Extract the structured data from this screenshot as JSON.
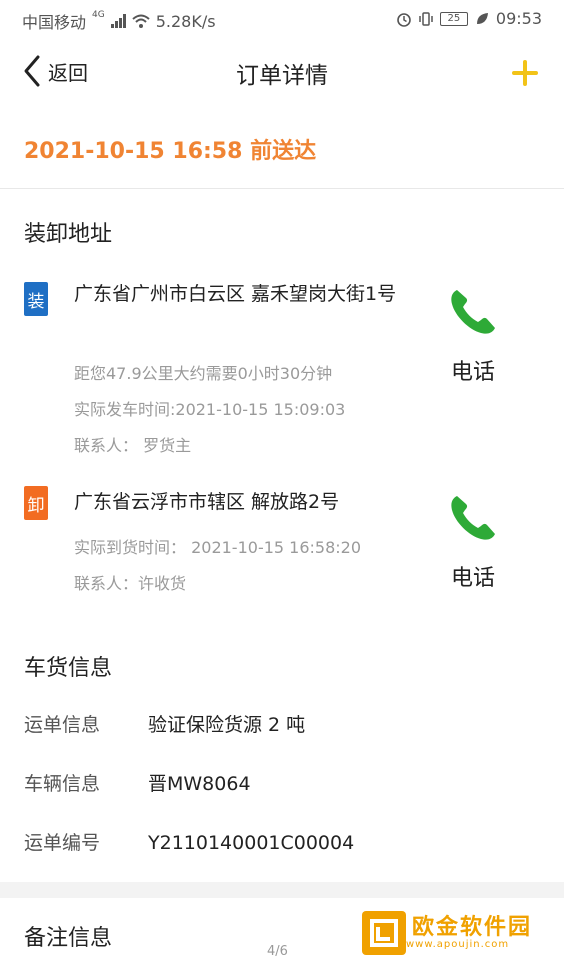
{
  "status_bar": {
    "carrier": "中国移动",
    "network_tag": "4G",
    "speed": "5.28K/s",
    "battery": "25",
    "time": "09:53"
  },
  "nav": {
    "back_label": "返回",
    "title": "订单详情",
    "add_icon": "plus-icon",
    "accent_color": "#f2c318"
  },
  "eta": {
    "datetime": "2021-10-15 16:58",
    "suffix": "前送达",
    "color": "#f08433"
  },
  "addresses": {
    "section_title": "装卸地址",
    "load": {
      "badge": "装",
      "address": "广东省广州市白云区 嘉禾望岗大街1号",
      "distance": "距您47.9公里大约需要0小时30分钟",
      "depart_time": "实际发车时间:2021-10-15 15:09:03",
      "contact": "联系人：  罗货主",
      "call_label": "电话"
    },
    "unload": {
      "badge": "卸",
      "address": "广东省云浮市市辖区 解放路2号",
      "arrive_time": "实际到货时间：  2021-10-15 16:58:20",
      "contact": "联系人：许收货",
      "call_label": "电话"
    }
  },
  "cargo": {
    "section_title": "车货信息",
    "rows": [
      {
        "key": "运单信息",
        "value": "验证保险货源 2 吨"
      },
      {
        "key": "车辆信息",
        "value": "晋MW8064"
      },
      {
        "key": "运单编号",
        "value": "Y2110140001C00004"
      }
    ]
  },
  "remarks": {
    "section_title": "备注信息"
  },
  "page_indicator": "4/6",
  "watermark": {
    "text": "欧金软件园",
    "sub": "www.apoujin.com"
  }
}
